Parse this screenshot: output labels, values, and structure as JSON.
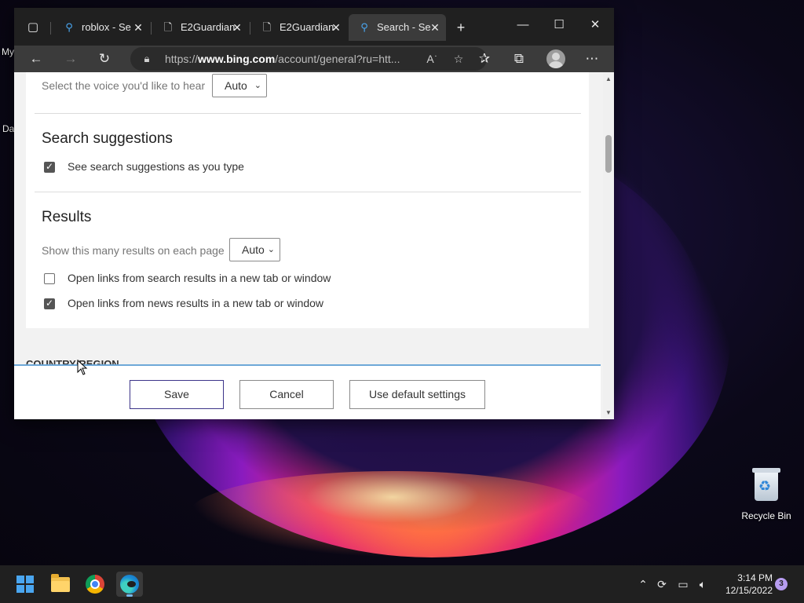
{
  "desktop": {
    "left_label_1": "My",
    "left_label_2": "Da",
    "recycle_bin_label": "Recycle Bin"
  },
  "browser": {
    "tabs": [
      {
        "title": "roblox - Se",
        "icon": "search-icon",
        "active": false
      },
      {
        "title": "E2Guardian",
        "icon": "page-icon",
        "active": false
      },
      {
        "title": "E2Guardian",
        "icon": "page-icon",
        "active": false
      },
      {
        "title": "Search - Se",
        "icon": "search-icon",
        "active": true
      }
    ],
    "address": {
      "url_prefix": "https://",
      "url_domain": "www.bing.com",
      "url_path": "/account/general?ru=htt..."
    }
  },
  "settings": {
    "voice_label": "Select the voice you'd like to hear",
    "voice_value": "Auto",
    "search_suggestions_heading": "Search suggestions",
    "see_suggestions_label": "See search suggestions as you type",
    "see_suggestions_checked": true,
    "results_heading": "Results",
    "results_count_label": "Show this many results on each page",
    "results_count_value": "Auto",
    "open_search_links_label": "Open links from search results in a new tab or window",
    "open_search_links_checked": false,
    "open_news_links_label": "Open links from news results in a new tab or window",
    "open_news_links_checked": true,
    "country_heading": "COUNTRY/REGION"
  },
  "footer": {
    "save_label": "Save",
    "cancel_label": "Cancel",
    "default_label": "Use default settings"
  },
  "taskbar": {
    "time": "3:14 PM",
    "date": "12/15/2022",
    "notification_count": "3"
  },
  "colors": {
    "accent": "#3c3489",
    "footer_border": "#6ea8d8",
    "edge_blue": "#1b8fd6"
  }
}
